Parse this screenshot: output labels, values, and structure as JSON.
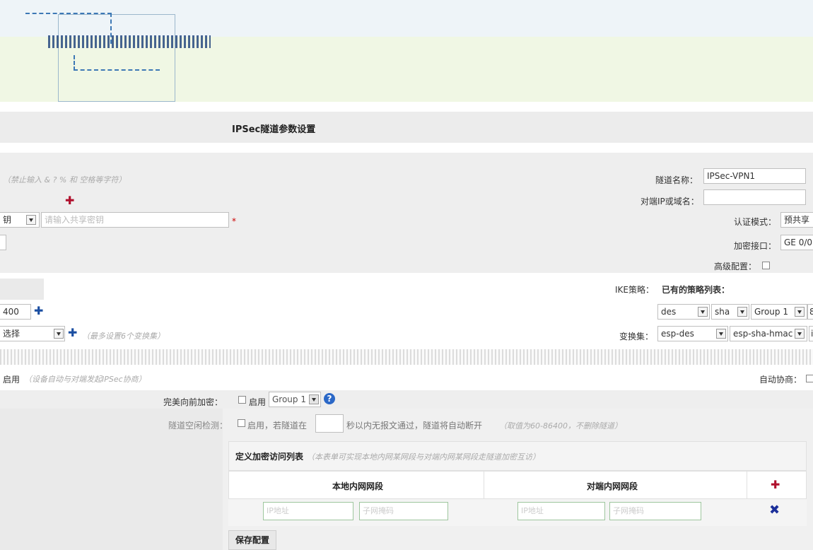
{
  "section_title": "IPSec隧道参数设置",
  "hints": {
    "no_special_chars": "（禁止输入 & ? % 和 空格等字符）",
    "max_transforms": "（最多设置6个变换集）",
    "auto_negotiate": "（设备自动与对端发起IPSec协商）"
  },
  "fields": {
    "tunnel_name_label": "隧道名称：",
    "tunnel_name_value": "IPSec-VPN1",
    "peer_label": "对端IP或域名：",
    "auth_mode_label": "认证模式：",
    "auth_mode_value": "预共享",
    "key_partial": "钥",
    "key_placeholder": "请输入共享密钥",
    "encrypt_iface_label": "加密接口：",
    "encrypt_iface_value": "GE 0/0",
    "advanced_label": "高级配置：",
    "ike_policy_label": "IKE策略：",
    "existing_policies_label": "已有的策略列表：",
    "lifetime_value": "400",
    "ike_encrypt": "des",
    "ike_hash": "sha",
    "ike_group": "Group 1",
    "ike_extra": "8",
    "transform_label": "变换集：",
    "transform_select_partial": "选择",
    "transform_esp": "esp-des",
    "transform_hash": "esp-sha-hmac",
    "transform_extra": "i",
    "enable_partial": "启用",
    "auto_negotiate_label": "自动协商：",
    "pfs_label": "完美向前加密：",
    "pfs_enable": "启用",
    "pfs_group": "Group 1",
    "dpd_label": "隧道空闲检测：",
    "dpd_enable": "启用，若隧道在",
    "dpd_suffix": "秒以内无报文通过，隧道将自动断开",
    "dpd_range": "（取值为60-86400，不删除隧道）"
  },
  "acl": {
    "title": "定义加密访问列表",
    "subtitle": "（本表单可实现本地内网某网段与对端内网某网段走隧道加密互访）",
    "col_local": "本地内网网段",
    "col_remote": "对端内网网段",
    "ip_placeholder": "IP地址",
    "mask_placeholder": "子网掩码"
  },
  "save_button": "保存配置",
  "colors": {
    "header_bg": "#eef3ee",
    "green_band": "#f0f7e4",
    "accent_blue": "#1b4ea1",
    "accent_red": "#b0102d",
    "border": "#bfbfbf"
  }
}
